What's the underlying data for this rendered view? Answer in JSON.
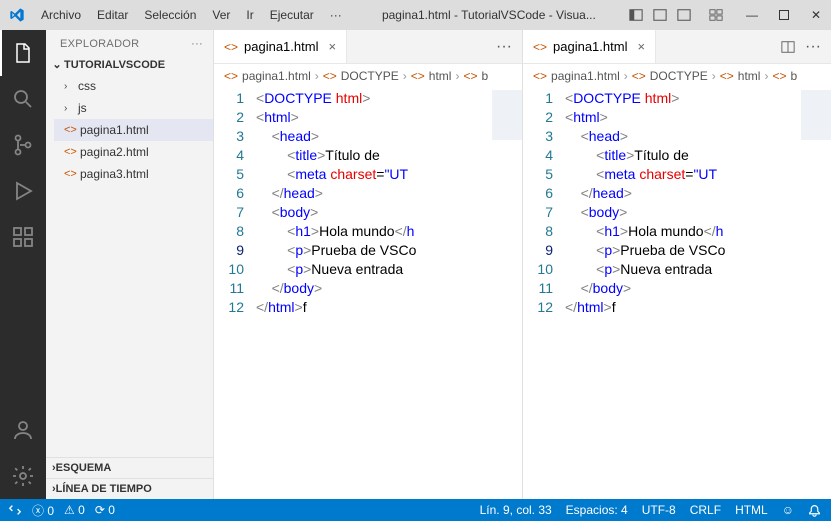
{
  "title_bar": {
    "menu": [
      "Archivo",
      "Editar",
      "Selección",
      "Ver",
      "Ir",
      "Ejecutar"
    ],
    "more": "···",
    "title": "pagina1.html - TutorialVSCode - Visua..."
  },
  "sidebar": {
    "header": "EXPLORADOR",
    "project": "TUTORIALVSCODE",
    "items": [
      {
        "label": "css",
        "type": "folder"
      },
      {
        "label": "js",
        "type": "folder"
      },
      {
        "label": "pagina1.html",
        "type": "file",
        "selected": true
      },
      {
        "label": "pagina2.html",
        "type": "file"
      },
      {
        "label": "pagina3.html",
        "type": "file"
      }
    ],
    "esquema": "ESQUEMA",
    "linea": "LÍNEA DE TIEMPO"
  },
  "editor": {
    "tab_label": "pagina1.html",
    "breadcrumb": [
      "pagina1.html",
      "DOCTYPE",
      "html",
      "b"
    ],
    "code": [
      {
        "n": 1,
        "ind": 0,
        "tokens": [
          [
            "<",
            "t-gray"
          ],
          [
            "DOCTYPE ",
            "t-blue"
          ],
          [
            "html",
            "t-red"
          ],
          [
            ">",
            "t-gray"
          ]
        ]
      },
      {
        "n": 2,
        "ind": 0,
        "tokens": [
          [
            "<",
            "t-gray"
          ],
          [
            "html",
            "t-blue"
          ],
          [
            ">",
            "t-gray"
          ]
        ]
      },
      {
        "n": 3,
        "ind": 1,
        "tokens": [
          [
            "<",
            "t-gray"
          ],
          [
            "head",
            "t-blue"
          ],
          [
            ">",
            "t-gray"
          ]
        ]
      },
      {
        "n": 4,
        "ind": 2,
        "tokens": [
          [
            "<",
            "t-gray"
          ],
          [
            "title",
            "t-blue"
          ],
          [
            ">",
            "t-gray"
          ],
          [
            "Título de ",
            "t-black"
          ]
        ]
      },
      {
        "n": 5,
        "ind": 2,
        "tokens": [
          [
            "<",
            "t-gray"
          ],
          [
            "meta ",
            "t-blue"
          ],
          [
            "charset",
            "t-red"
          ],
          [
            "=",
            "t-black"
          ],
          [
            "\"UT",
            "t-blue"
          ]
        ]
      },
      {
        "n": 6,
        "ind": 1,
        "tokens": [
          [
            "</",
            "t-gray"
          ],
          [
            "head",
            "t-blue"
          ],
          [
            ">",
            "t-gray"
          ]
        ]
      },
      {
        "n": 7,
        "ind": 1,
        "tokens": [
          [
            "<",
            "t-gray"
          ],
          [
            "body",
            "t-blue"
          ],
          [
            ">",
            "t-gray"
          ]
        ]
      },
      {
        "n": 8,
        "ind": 2,
        "tokens": [
          [
            "<",
            "t-gray"
          ],
          [
            "h1",
            "t-blue"
          ],
          [
            ">",
            "t-gray"
          ],
          [
            "Hola mundo",
            "t-black"
          ],
          [
            "</",
            "t-gray"
          ],
          [
            "h",
            "t-blue"
          ]
        ]
      },
      {
        "n": 9,
        "ind": 2,
        "tokens": [
          [
            "<",
            "t-gray"
          ],
          [
            "p",
            "t-blue"
          ],
          [
            ">",
            "t-gray"
          ],
          [
            "Prueba de VSCo",
            "t-black"
          ]
        ]
      },
      {
        "n": 10,
        "ind": 2,
        "tokens": [
          [
            "<",
            "t-gray"
          ],
          [
            "p",
            "t-blue"
          ],
          [
            ">",
            "t-gray"
          ],
          [
            "Nueva entrada",
            "t-black"
          ]
        ]
      },
      {
        "n": 11,
        "ind": 1,
        "tokens": [
          [
            "</",
            "t-gray"
          ],
          [
            "body",
            "t-blue"
          ],
          [
            ">",
            "t-gray"
          ]
        ]
      },
      {
        "n": 12,
        "ind": 0,
        "tokens": [
          [
            "</",
            "t-gray"
          ],
          [
            "html",
            "t-blue"
          ],
          [
            ">",
            "t-gray"
          ],
          [
            "f",
            "t-black"
          ]
        ]
      }
    ],
    "current_line": 9
  },
  "status": {
    "errors": "0",
    "warnings": "0",
    "radio": "0",
    "ln_col": "Lín. 9, col. 33",
    "spaces": "Espacios: 4",
    "encoding": "UTF-8",
    "eol": "CRLF",
    "lang": "HTML"
  }
}
